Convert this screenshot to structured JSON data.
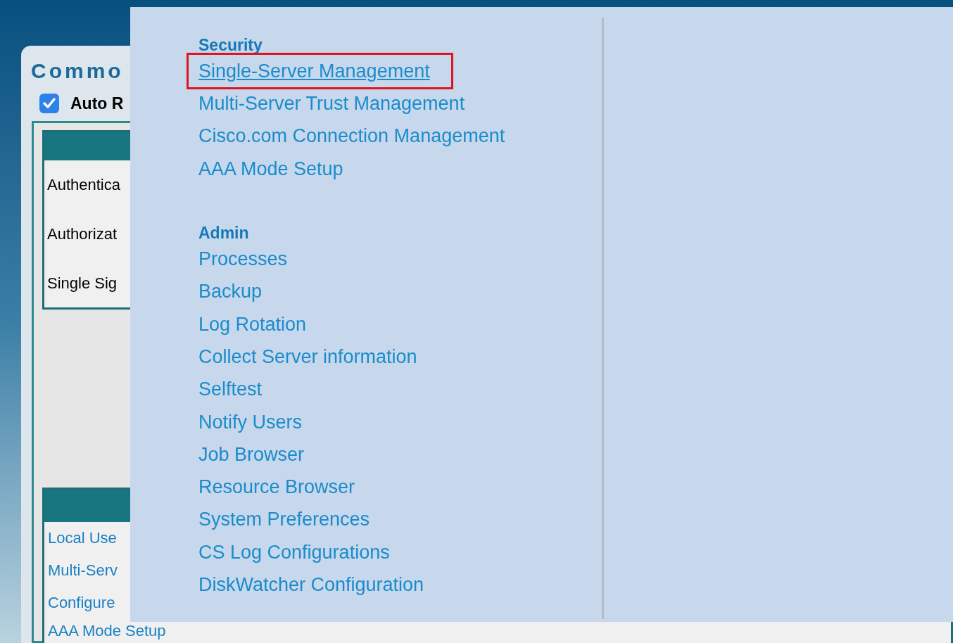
{
  "page": {
    "title": "Commo",
    "auto_refresh": {
      "label": "Auto R",
      "checked": true
    }
  },
  "summary_table": {
    "rows": [
      "Authentica",
      "Authorizat",
      "Single Sig"
    ]
  },
  "links_table": {
    "links": [
      "Local Use",
      "Multi-Serv",
      "Configure",
      "AAA Mode Setup"
    ]
  },
  "menu": {
    "sections": [
      {
        "title": "Security",
        "items": [
          {
            "label": "Single-Server Management",
            "highlighted": true
          },
          {
            "label": "Multi-Server Trust Management",
            "highlighted": false
          },
          {
            "label": "Cisco.com Connection Management",
            "highlighted": false
          },
          {
            "label": "AAA Mode Setup",
            "highlighted": false
          }
        ]
      },
      {
        "title": "Admin",
        "items": [
          {
            "label": "Processes",
            "highlighted": false
          },
          {
            "label": "Backup",
            "highlighted": false
          },
          {
            "label": "Log Rotation",
            "highlighted": false
          },
          {
            "label": "Collect Server information",
            "highlighted": false
          },
          {
            "label": "Selftest",
            "highlighted": false
          },
          {
            "label": "Notify Users",
            "highlighted": false
          },
          {
            "label": "Job Browser",
            "highlighted": false
          },
          {
            "label": "Resource Browser",
            "highlighted": false
          },
          {
            "label": "System Preferences",
            "highlighted": false
          },
          {
            "label": "CS Log Configurations",
            "highlighted": false
          },
          {
            "label": "DiskWatcher Configuration",
            "highlighted": false
          }
        ]
      }
    ]
  }
}
